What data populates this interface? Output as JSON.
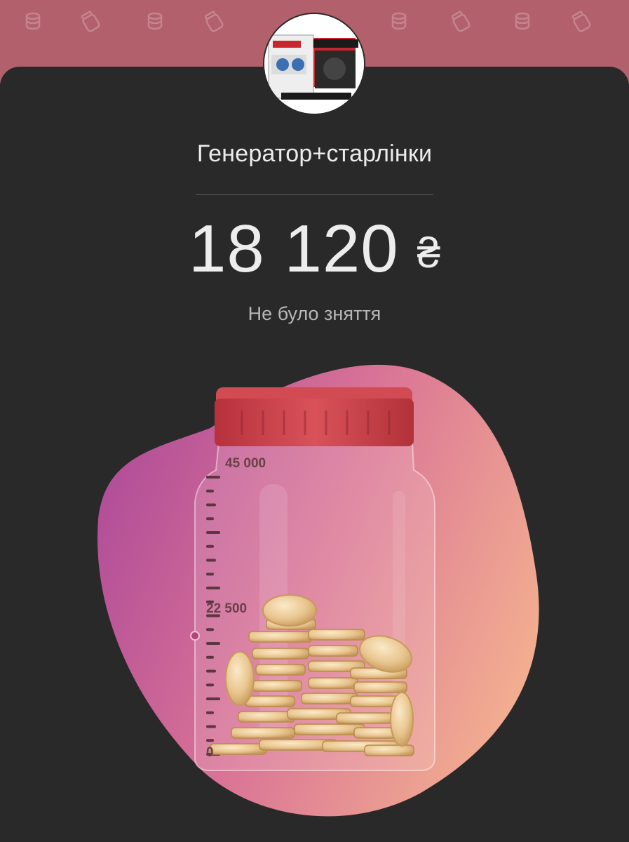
{
  "jar": {
    "title": "Генератор+старлінки",
    "amount": "18 120",
    "currency": "₴",
    "status": "Не було зняття",
    "scale": {
      "max_label": "45 000",
      "mid_label": "22 500",
      "min_label": "0",
      "max_value": 45000,
      "current_value": 18120
    }
  },
  "avatar": {
    "icon": "generator-photo-icon"
  },
  "colors": {
    "band": "#b2606b",
    "card": "#2a292a",
    "lid": "#c7434d",
    "blob_start": "#b55096",
    "blob_end": "#f2a98a",
    "marker": "#b0457a"
  },
  "pattern_icons": [
    "coins-icon",
    "jar-icon"
  ]
}
